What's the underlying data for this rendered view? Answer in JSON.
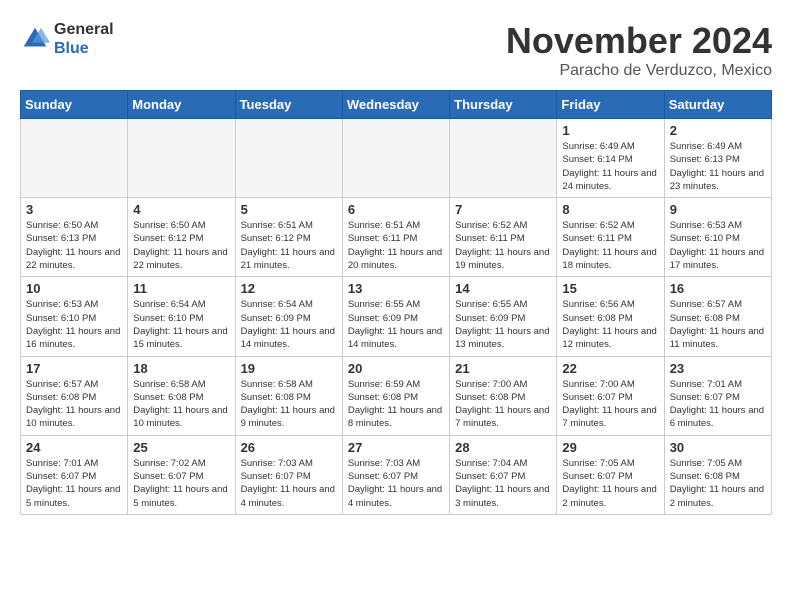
{
  "logo": {
    "general": "General",
    "blue": "Blue"
  },
  "title": "November 2024",
  "location": "Paracho de Verduzco, Mexico",
  "days_of_week": [
    "Sunday",
    "Monday",
    "Tuesday",
    "Wednesday",
    "Thursday",
    "Friday",
    "Saturday"
  ],
  "weeks": [
    [
      {
        "day": "",
        "info": ""
      },
      {
        "day": "",
        "info": ""
      },
      {
        "day": "",
        "info": ""
      },
      {
        "day": "",
        "info": ""
      },
      {
        "day": "",
        "info": ""
      },
      {
        "day": "1",
        "info": "Sunrise: 6:49 AM\nSunset: 6:14 PM\nDaylight: 11 hours and 24 minutes."
      },
      {
        "day": "2",
        "info": "Sunrise: 6:49 AM\nSunset: 6:13 PM\nDaylight: 11 hours and 23 minutes."
      }
    ],
    [
      {
        "day": "3",
        "info": "Sunrise: 6:50 AM\nSunset: 6:13 PM\nDaylight: 11 hours and 22 minutes."
      },
      {
        "day": "4",
        "info": "Sunrise: 6:50 AM\nSunset: 6:12 PM\nDaylight: 11 hours and 22 minutes."
      },
      {
        "day": "5",
        "info": "Sunrise: 6:51 AM\nSunset: 6:12 PM\nDaylight: 11 hours and 21 minutes."
      },
      {
        "day": "6",
        "info": "Sunrise: 6:51 AM\nSunset: 6:11 PM\nDaylight: 11 hours and 20 minutes."
      },
      {
        "day": "7",
        "info": "Sunrise: 6:52 AM\nSunset: 6:11 PM\nDaylight: 11 hours and 19 minutes."
      },
      {
        "day": "8",
        "info": "Sunrise: 6:52 AM\nSunset: 6:11 PM\nDaylight: 11 hours and 18 minutes."
      },
      {
        "day": "9",
        "info": "Sunrise: 6:53 AM\nSunset: 6:10 PM\nDaylight: 11 hours and 17 minutes."
      }
    ],
    [
      {
        "day": "10",
        "info": "Sunrise: 6:53 AM\nSunset: 6:10 PM\nDaylight: 11 hours and 16 minutes."
      },
      {
        "day": "11",
        "info": "Sunrise: 6:54 AM\nSunset: 6:10 PM\nDaylight: 11 hours and 15 minutes."
      },
      {
        "day": "12",
        "info": "Sunrise: 6:54 AM\nSunset: 6:09 PM\nDaylight: 11 hours and 14 minutes."
      },
      {
        "day": "13",
        "info": "Sunrise: 6:55 AM\nSunset: 6:09 PM\nDaylight: 11 hours and 14 minutes."
      },
      {
        "day": "14",
        "info": "Sunrise: 6:55 AM\nSunset: 6:09 PM\nDaylight: 11 hours and 13 minutes."
      },
      {
        "day": "15",
        "info": "Sunrise: 6:56 AM\nSunset: 6:08 PM\nDaylight: 11 hours and 12 minutes."
      },
      {
        "day": "16",
        "info": "Sunrise: 6:57 AM\nSunset: 6:08 PM\nDaylight: 11 hours and 11 minutes."
      }
    ],
    [
      {
        "day": "17",
        "info": "Sunrise: 6:57 AM\nSunset: 6:08 PM\nDaylight: 11 hours and 10 minutes."
      },
      {
        "day": "18",
        "info": "Sunrise: 6:58 AM\nSunset: 6:08 PM\nDaylight: 11 hours and 10 minutes."
      },
      {
        "day": "19",
        "info": "Sunrise: 6:58 AM\nSunset: 6:08 PM\nDaylight: 11 hours and 9 minutes."
      },
      {
        "day": "20",
        "info": "Sunrise: 6:59 AM\nSunset: 6:08 PM\nDaylight: 11 hours and 8 minutes."
      },
      {
        "day": "21",
        "info": "Sunrise: 7:00 AM\nSunset: 6:08 PM\nDaylight: 11 hours and 7 minutes."
      },
      {
        "day": "22",
        "info": "Sunrise: 7:00 AM\nSunset: 6:07 PM\nDaylight: 11 hours and 7 minutes."
      },
      {
        "day": "23",
        "info": "Sunrise: 7:01 AM\nSunset: 6:07 PM\nDaylight: 11 hours and 6 minutes."
      }
    ],
    [
      {
        "day": "24",
        "info": "Sunrise: 7:01 AM\nSunset: 6:07 PM\nDaylight: 11 hours and 5 minutes."
      },
      {
        "day": "25",
        "info": "Sunrise: 7:02 AM\nSunset: 6:07 PM\nDaylight: 11 hours and 5 minutes."
      },
      {
        "day": "26",
        "info": "Sunrise: 7:03 AM\nSunset: 6:07 PM\nDaylight: 11 hours and 4 minutes."
      },
      {
        "day": "27",
        "info": "Sunrise: 7:03 AM\nSunset: 6:07 PM\nDaylight: 11 hours and 4 minutes."
      },
      {
        "day": "28",
        "info": "Sunrise: 7:04 AM\nSunset: 6:07 PM\nDaylight: 11 hours and 3 minutes."
      },
      {
        "day": "29",
        "info": "Sunrise: 7:05 AM\nSunset: 6:07 PM\nDaylight: 11 hours and 2 minutes."
      },
      {
        "day": "30",
        "info": "Sunrise: 7:05 AM\nSunset: 6:08 PM\nDaylight: 11 hours and 2 minutes."
      }
    ]
  ]
}
